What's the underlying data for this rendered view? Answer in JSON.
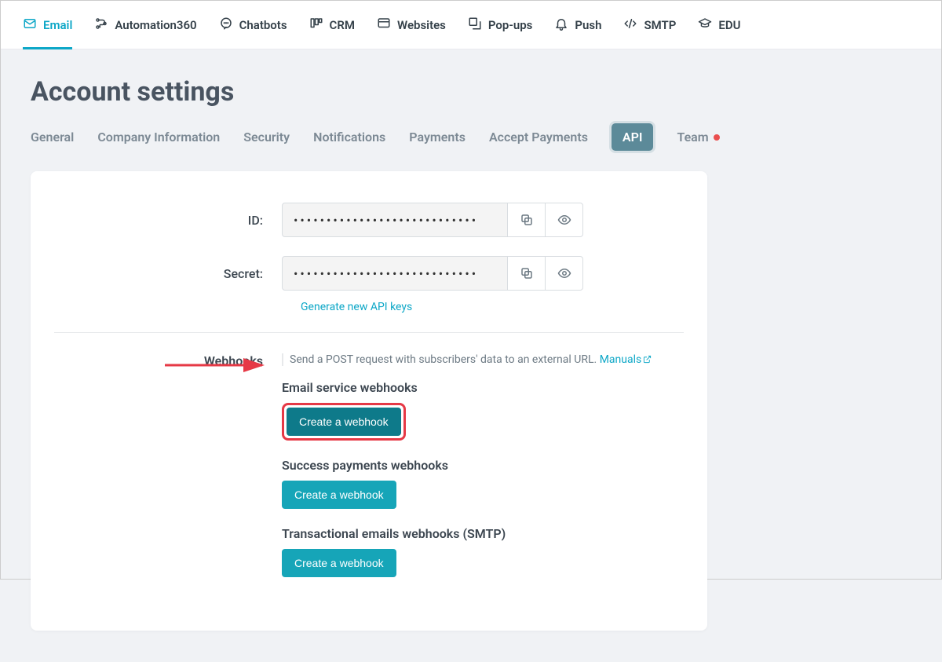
{
  "topnav": [
    {
      "label": "Email",
      "name": "nav-email",
      "icon": "mail",
      "active": true
    },
    {
      "label": "Automation360",
      "name": "nav-automation360",
      "icon": "automation"
    },
    {
      "label": "Chatbots",
      "name": "nav-chatbots",
      "icon": "chat"
    },
    {
      "label": "CRM",
      "name": "nav-crm",
      "icon": "crm"
    },
    {
      "label": "Websites",
      "name": "nav-websites",
      "icon": "website"
    },
    {
      "label": "Pop-ups",
      "name": "nav-popups",
      "icon": "popup"
    },
    {
      "label": "Push",
      "name": "nav-push",
      "icon": "bell"
    },
    {
      "label": "SMTP",
      "name": "nav-smtp",
      "icon": "code"
    },
    {
      "label": "EDU",
      "name": "nav-edu",
      "icon": "edu"
    }
  ],
  "page_title": "Account settings",
  "tabs": [
    {
      "label": "General",
      "name": "tab-general"
    },
    {
      "label": "Company Information",
      "name": "tab-company-information"
    },
    {
      "label": "Security",
      "name": "tab-security"
    },
    {
      "label": "Notifications",
      "name": "tab-notifications"
    },
    {
      "label": "Payments",
      "name": "tab-payments"
    },
    {
      "label": "Accept Payments",
      "name": "tab-accept-payments"
    },
    {
      "label": "API",
      "name": "tab-api",
      "active": true
    },
    {
      "label": "Team",
      "name": "tab-team",
      "badge": "red"
    }
  ],
  "api": {
    "id_label": "ID:",
    "id_value_masked": "••••••••••••••••••••••••••••",
    "secret_label": "Secret:",
    "secret_value_masked": "••••••••••••••••••••••••••••",
    "generate_link": "Generate new API keys"
  },
  "webhooks": {
    "section_label": "Webhooks",
    "description_prefix": "Send a POST request with subscribers' data to an external URL. ",
    "manuals_link": "Manuals",
    "groups": [
      {
        "title": "Email service webhooks",
        "button": "Create a webhook",
        "highlight": true
      },
      {
        "title": "Success payments webhooks",
        "button": "Create a webhook"
      },
      {
        "title": "Transactional emails webhooks (SMTP)",
        "button": "Create a webhook"
      }
    ]
  }
}
